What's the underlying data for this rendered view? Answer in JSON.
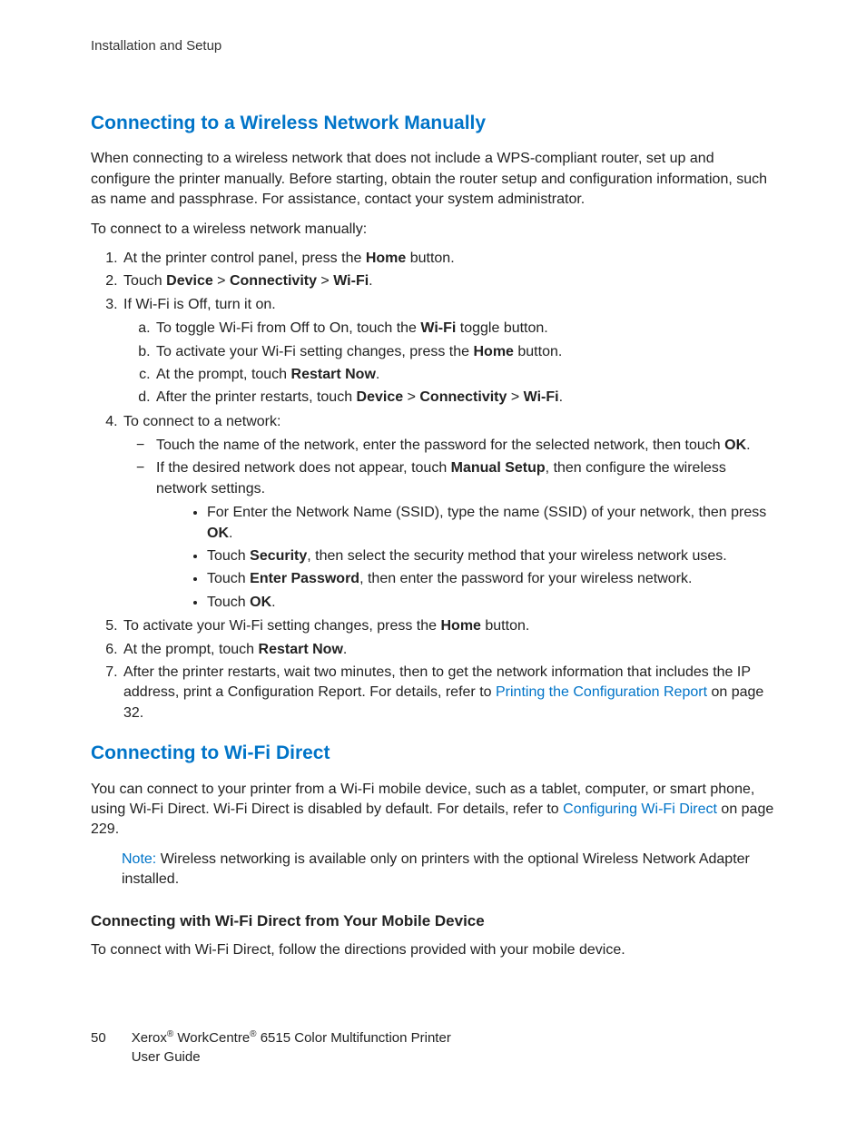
{
  "header": "Installation and Setup",
  "section1_title": "Connecting to a Wireless Network Manually",
  "s1_p1": "When connecting to a wireless network that does not include a WPS-compliant router, set up and configure the printer manually. Before starting, obtain the router setup and configuration information, such as name and passphrase. For assistance, contact your system administrator.",
  "s1_p2": "To connect to a wireless network manually:",
  "s1_li1_a": "At the printer control panel, press the ",
  "s1_li1_b": "Home",
  "s1_li1_c": " button.",
  "s1_li2_a": "Touch ",
  "s1_li2_b": "Device",
  "s1_li2_c": " > ",
  "s1_li2_d": "Connectivity",
  "s1_li2_e": " > ",
  "s1_li2_f": "Wi-Fi",
  "s1_li2_g": ".",
  "s1_li3": "If Wi-Fi is Off, turn it on.",
  "s1_li3a_a": "To toggle Wi-Fi from Off to On, touch the ",
  "s1_li3a_b": "Wi-Fi",
  "s1_li3a_c": " toggle button.",
  "s1_li3b_a": "To activate your Wi-Fi setting changes, press the ",
  "s1_li3b_b": "Home",
  "s1_li3b_c": " button.",
  "s1_li3c_a": "At the prompt, touch ",
  "s1_li3c_b": "Restart Now",
  "s1_li3c_c": ".",
  "s1_li3d_a": "After the printer restarts, touch ",
  "s1_li3d_b": "Device",
  "s1_li3d_c": " > ",
  "s1_li3d_d": "Connectivity",
  "s1_li3d_e": " > ",
  "s1_li3d_f": "Wi-Fi",
  "s1_li3d_g": ".",
  "s1_li4": "To connect to a network:",
  "s1_li4_d1_a": "Touch the name of the network, enter the password for the selected network, then touch ",
  "s1_li4_d1_b": "OK",
  "s1_li4_d1_c": ".",
  "s1_li4_d2_a": "If the desired network does not appear, touch ",
  "s1_li4_d2_b": "Manual Setup",
  "s1_li4_d2_c": ", then configure the wireless network settings.",
  "s1_li4_b1_a": "For Enter the Network Name (SSID), type the name (SSID) of your network, then press ",
  "s1_li4_b1_b": "OK",
  "s1_li4_b1_c": ".",
  "s1_li4_b2_a": "Touch ",
  "s1_li4_b2_b": "Security",
  "s1_li4_b2_c": ", then select the security method that your wireless network uses.",
  "s1_li4_b3_a": "Touch ",
  "s1_li4_b3_b": "Enter Password",
  "s1_li4_b3_c": ", then enter the password for your wireless network.",
  "s1_li4_b4_a": "Touch ",
  "s1_li4_b4_b": "OK",
  "s1_li4_b4_c": ".",
  "s1_li5_a": "To activate your Wi-Fi setting changes, press the ",
  "s1_li5_b": "Home",
  "s1_li5_c": " button.",
  "s1_li6_a": "At the prompt, touch ",
  "s1_li6_b": "Restart Now",
  "s1_li6_c": ".",
  "s1_li7_a": "After the printer restarts, wait two minutes, then to get the network information that includes the IP address, print a Configuration Report. For details, refer to ",
  "s1_li7_link": "Printing the Configuration Report",
  "s1_li7_b": " on page 32.",
  "section2_title": "Connecting to Wi-Fi Direct",
  "s2_p1_a": "You can connect to your printer from a Wi-Fi mobile device, such as a tablet, computer, or smart phone, using Wi-Fi Direct. Wi-Fi Direct is disabled by default. For details, refer to ",
  "s2_p1_link": "Configuring Wi-Fi Direct",
  "s2_p1_b": " on page 229.",
  "s2_note_label": "Note:",
  "s2_note_body": " Wireless networking is available only on printers with the optional Wireless Network Adapter installed.",
  "s2_sub_title": "Connecting with Wi-Fi Direct from Your Mobile Device",
  "s2_sub_p": "To connect with Wi-Fi Direct, follow the directions provided with your mobile device.",
  "footer_page": "50",
  "footer_a": "Xerox",
  "footer_b": " WorkCentre",
  "footer_c": " 6515 Color Multifunction Printer",
  "footer_d": "User Guide",
  "reg": "®"
}
